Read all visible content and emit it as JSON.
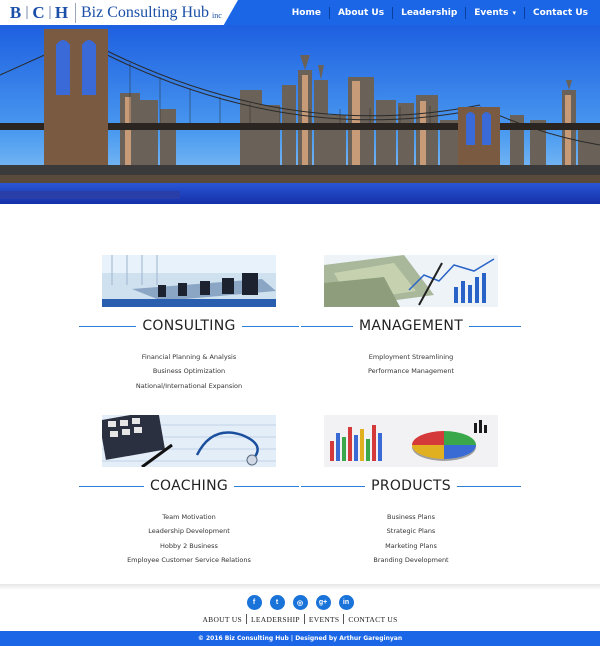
{
  "logo": {
    "letters": [
      "B",
      "C",
      "H"
    ],
    "name": "Biz Consulting Hub",
    "suffix": "inc"
  },
  "nav": {
    "items": [
      {
        "label": "Home"
      },
      {
        "label": "About Us"
      },
      {
        "label": "Leadership"
      },
      {
        "label": "Events",
        "dropdown": true
      },
      {
        "label": "Contact Us"
      }
    ]
  },
  "services": [
    {
      "title": "CONSULTING",
      "image": "conference-room",
      "items": [
        "Financial Planning & Analysis",
        "Business Optimization",
        "National/International Expansion"
      ]
    },
    {
      "title": "MANAGEMENT",
      "image": "money-charts",
      "items": [
        "Employment Streamlining",
        "Performance Management"
      ]
    },
    {
      "title": "COACHING",
      "image": "calculator-stethoscope",
      "items": [
        "Team Motivation",
        "Leadership Development",
        "Hobby 2 Business",
        "Employee Customer Service Relations"
      ]
    },
    {
      "title": "PRODUCTS",
      "image": "pie-bar-charts",
      "items": [
        "Business Plans",
        "Strategic Plans",
        "Marketing Plans",
        "Branding Development"
      ]
    }
  ],
  "footer": {
    "social": [
      "facebook-icon",
      "twitter-icon",
      "instagram-icon",
      "google-plus-icon",
      "linkedin-icon"
    ],
    "social_glyphs": [
      "f",
      "t",
      "◎",
      "g+",
      "in"
    ],
    "links": [
      "ABOUT US",
      "LEADERSHIP",
      "EVENTS",
      "CONTACT US"
    ],
    "copyright": "© 2016 Biz Consulting Hub | Designed by Arthur Gareginyan"
  },
  "colors": {
    "brand_blue": "#1a66e6",
    "logo_blue": "#1b4fa8",
    "accent_line": "#2c7fd6"
  }
}
